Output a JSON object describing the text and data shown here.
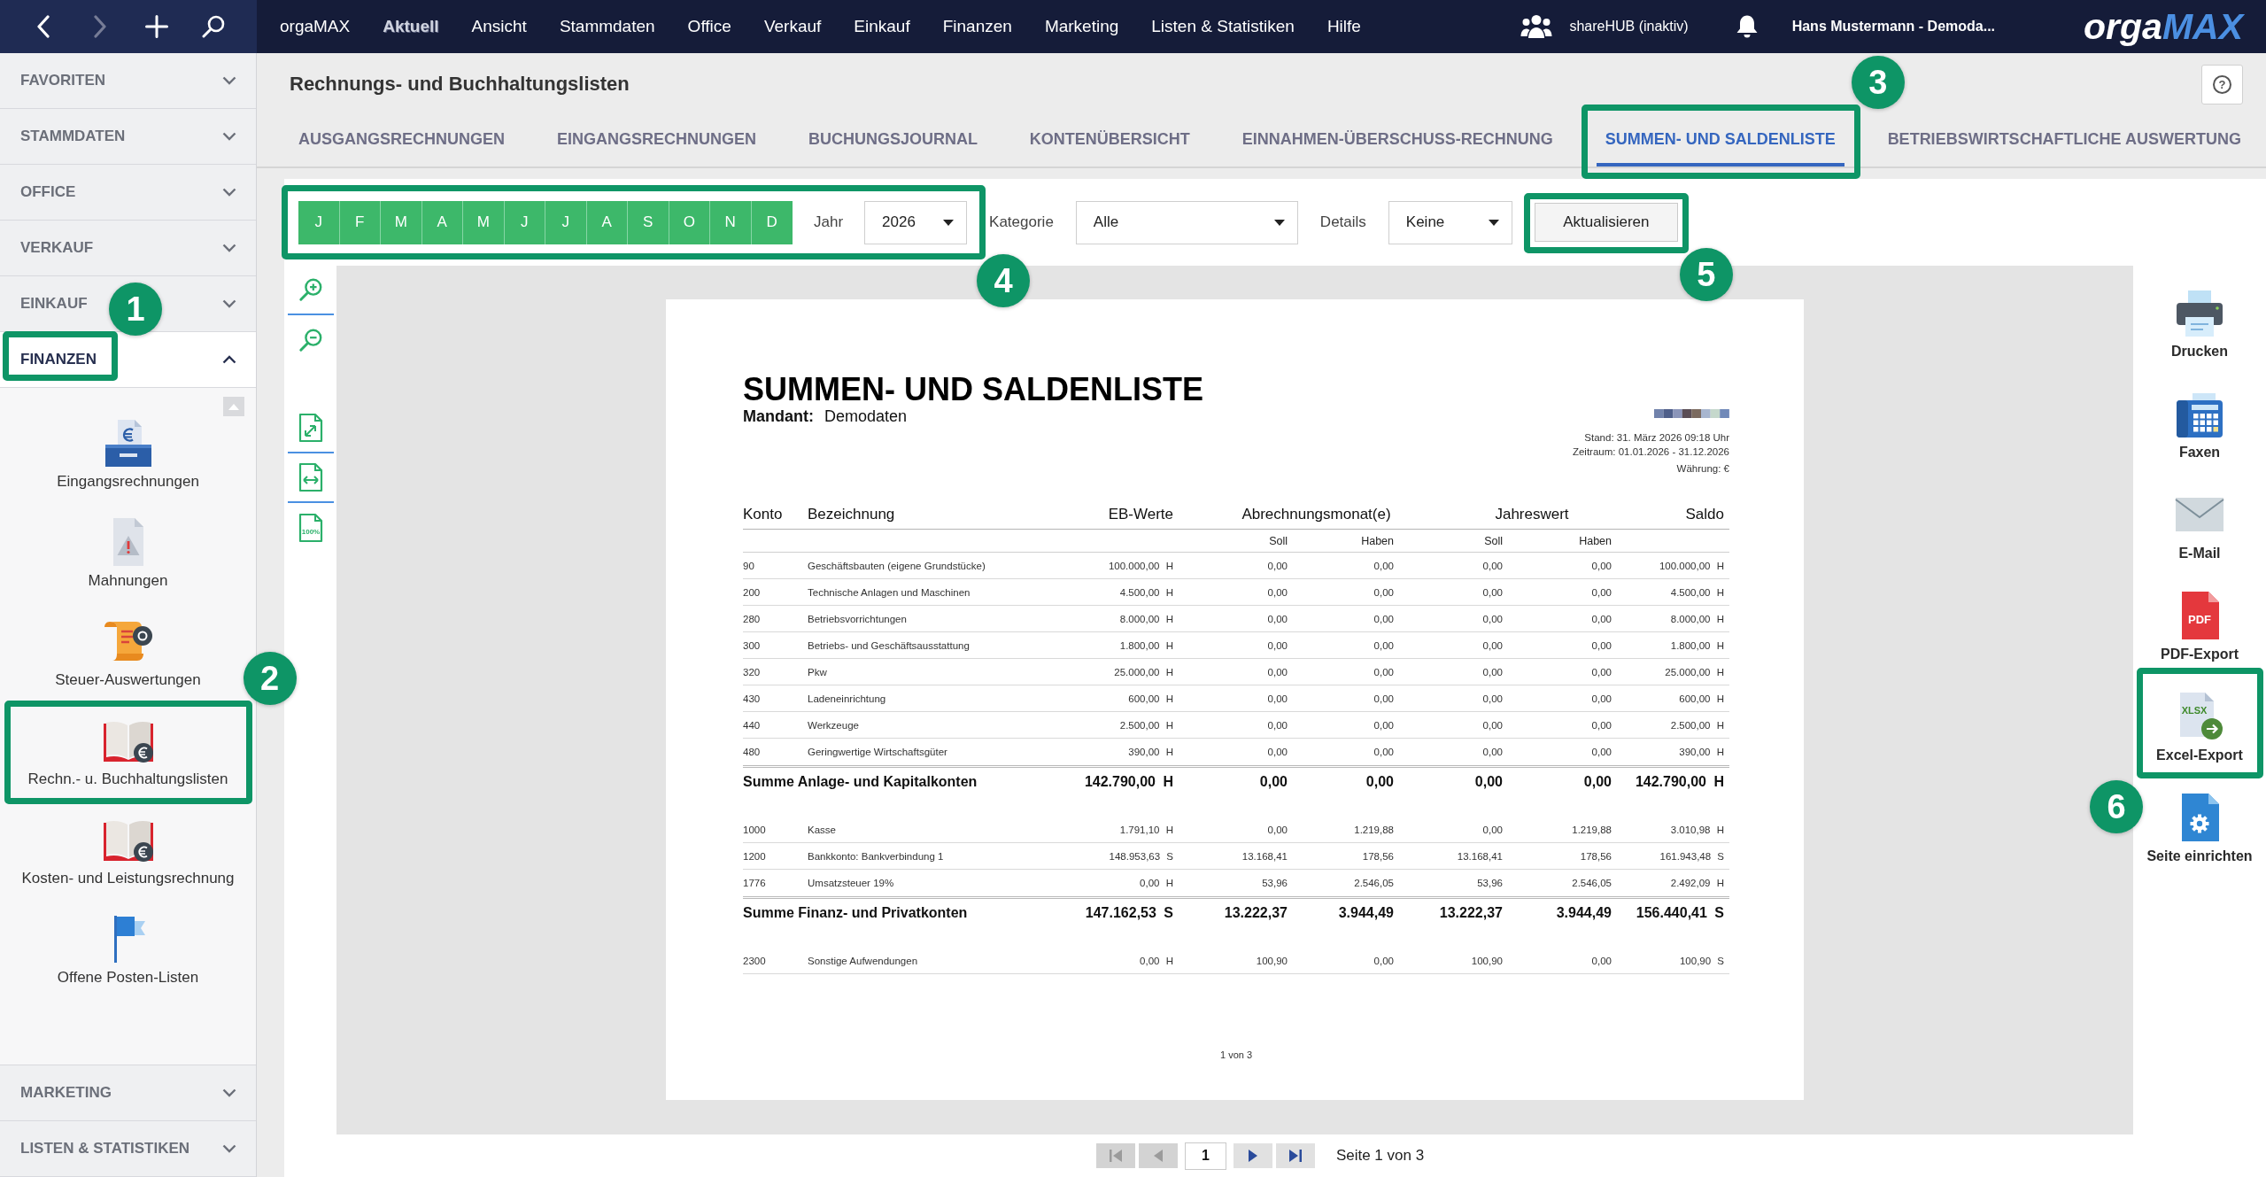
{
  "top_bar": {
    "nav": [
      {
        "kind": "back",
        "disabled": false
      },
      {
        "kind": "forward",
        "disabled": true
      },
      {
        "kind": "add",
        "disabled": false
      },
      {
        "kind": "search",
        "disabled": false
      }
    ],
    "menu": [
      {
        "label": "orgaMAX",
        "selected": false
      },
      {
        "label": "Aktuell",
        "selected": true
      },
      {
        "label": "Ansicht",
        "selected": false
      },
      {
        "label": "Stammdaten",
        "selected": false
      },
      {
        "label": "Office",
        "selected": false
      },
      {
        "label": "Verkauf",
        "selected": false
      },
      {
        "label": "Einkauf",
        "selected": false
      },
      {
        "label": "Finanzen",
        "selected": false
      },
      {
        "label": "Marketing",
        "selected": false
      },
      {
        "label": "Listen & Statistiken",
        "selected": false
      },
      {
        "label": "Hilfe",
        "selected": false
      }
    ],
    "sharehub": "shareHUB (inaktiv)",
    "user": "Hans Mustermann - Demoda...",
    "logo": {
      "first": "orga",
      "second": "MAX"
    }
  },
  "sidebar": {
    "sections": [
      {
        "label": "FAVORITEN",
        "expanded": false
      },
      {
        "label": "STAMMDATEN",
        "expanded": false
      },
      {
        "label": "OFFICE",
        "expanded": false
      },
      {
        "label": "VERKAUF",
        "expanded": false
      },
      {
        "label": "EINKAUF",
        "expanded": false
      },
      {
        "label": "FINANZEN",
        "expanded": true,
        "callout": {
          "number": "1"
        },
        "items": [
          {
            "label": "Eingangsrechnungen",
            "kind": "inbox"
          },
          {
            "label": "Mahnungen",
            "kind": "warning"
          },
          {
            "label": "Steuer-Auswertungen",
            "kind": "scroll"
          },
          {
            "label": "Rechn.- u. Buchhaltungslisten",
            "kind": "book",
            "callout": {
              "number": "2"
            }
          },
          {
            "label": "Kosten- und Leistungsrechnung",
            "kind": "book"
          },
          {
            "label": "Offene Posten-Listen",
            "kind": "flag"
          }
        ]
      },
      {
        "label": "MARKETING",
        "expanded": false
      },
      {
        "label": "LISTEN & STATISTIKEN",
        "expanded": false
      }
    ]
  },
  "view": {
    "title": "Rechnungs- und Buchhaltungslisten",
    "help_button": "?",
    "tabs": [
      {
        "label": "AUSGANGSRECHNUNGEN",
        "selected": false
      },
      {
        "label": "EINGANGSRECHNUNGEN",
        "selected": false
      },
      {
        "label": "BUCHUNGSJOURNAL",
        "selected": false
      },
      {
        "label": "KONTENÜBERSICHT",
        "selected": false
      },
      {
        "label": "EINNAHMEN-ÜBERSCHUSS-RECHNUNG",
        "selected": false
      },
      {
        "label": "SUMMEN- UND SALDENLISTE",
        "selected": true,
        "callout": {
          "number": "3"
        }
      },
      {
        "label": "BETRIEBSWIRTSCHAFTLICHE AUSWERTUNG",
        "selected": false
      }
    ]
  },
  "toolbar": {
    "months": [
      {
        "label": "J",
        "selected": true
      },
      {
        "label": "F",
        "selected": true
      },
      {
        "label": "M",
        "selected": true
      },
      {
        "label": "A",
        "selected": true
      },
      {
        "label": "M",
        "selected": true
      },
      {
        "label": "J",
        "selected": true
      },
      {
        "label": "J",
        "selected": true
      },
      {
        "label": "A",
        "selected": true
      },
      {
        "label": "S",
        "selected": true
      },
      {
        "label": "O",
        "selected": true
      },
      {
        "label": "N",
        "selected": true
      },
      {
        "label": "D",
        "selected": true
      }
    ],
    "year": {
      "label": "Jahr",
      "value": "2026"
    },
    "callout": {
      "number": "4"
    },
    "category": {
      "label": "Kategorie",
      "value": "Alle"
    },
    "details": {
      "label": "Details",
      "value": "Keine"
    },
    "refresh": {
      "label": "Aktualisieren",
      "callout": {
        "number": "5"
      }
    }
  },
  "view_tools": [
    {
      "kind": "zoom-in"
    },
    {
      "kind": "zoom-out"
    },
    {
      "kind": "fit-page"
    },
    {
      "kind": "fit-width"
    },
    {
      "kind": "actual-size",
      "label": "100%"
    }
  ],
  "report": {
    "title": "SUMMEN- UND SALDENLISTE",
    "client_label": "Mandant:",
    "client": "Demodaten",
    "meta": [
      "Stand: 31. März 2026 09:18 Uhr",
      "Zeitraum: 01.01.2026 - 31.12.2026",
      "Währung: €"
    ],
    "columns": [
      "Konto",
      "Bezeichnung",
      "EB-Werte",
      "Abrechnungsmonat(e)",
      "Jahreswert",
      "Saldo"
    ],
    "subcolumns": [
      "Soll",
      "Haben",
      "Soll",
      "Haben"
    ],
    "groups": [
      {
        "rows": [
          {
            "account": "90",
            "name": "Geschäftsbauten (eigene Grundstücke)",
            "opening": "100.000,00 H",
            "month_debit": "0,00",
            "month_credit": "0,00",
            "year_debit": "0,00",
            "year_credit": "0,00",
            "balance": "100.000,00 H"
          },
          {
            "account": "200",
            "name": "Technische Anlagen und Maschinen",
            "opening": "4.500,00 H",
            "month_debit": "0,00",
            "month_credit": "0,00",
            "year_debit": "0,00",
            "year_credit": "0,00",
            "balance": "4.500,00 H"
          },
          {
            "account": "280",
            "name": "Betriebsvorrichtungen",
            "opening": "8.000,00 H",
            "month_debit": "0,00",
            "month_credit": "0,00",
            "year_debit": "0,00",
            "year_credit": "0,00",
            "balance": "8.000,00 H"
          },
          {
            "account": "300",
            "name": "Betriebs- und Geschäftsausstattung",
            "opening": "1.800,00 H",
            "month_debit": "0,00",
            "month_credit": "0,00",
            "year_debit": "0,00",
            "year_credit": "0,00",
            "balance": "1.800,00 H"
          },
          {
            "account": "320",
            "name": "Pkw",
            "opening": "25.000,00 H",
            "month_debit": "0,00",
            "month_credit": "0,00",
            "year_debit": "0,00",
            "year_credit": "0,00",
            "balance": "25.000,00 H"
          },
          {
            "account": "430",
            "name": "Ladeneinrichtung",
            "opening": "600,00 H",
            "month_debit": "0,00",
            "month_credit": "0,00",
            "year_debit": "0,00",
            "year_credit": "0,00",
            "balance": "600,00 H"
          },
          {
            "account": "440",
            "name": "Werkzeuge",
            "opening": "2.500,00 H",
            "month_debit": "0,00",
            "month_credit": "0,00",
            "year_debit": "0,00",
            "year_credit": "0,00",
            "balance": "2.500,00 H"
          },
          {
            "account": "480",
            "name": "Geringwertige Wirtschaftsgüter",
            "opening": "390,00 H",
            "month_debit": "0,00",
            "month_credit": "0,00",
            "year_debit": "0,00",
            "year_credit": "0,00",
            "balance": "390,00 H"
          }
        ],
        "total": {
          "label": "Summe Anlage- und Kapitalkonten",
          "opening": "142.790,00 H",
          "month_debit": "0,00",
          "month_credit": "0,00",
          "year_debit": "0,00",
          "year_credit": "0,00",
          "balance": "142.790,00 H"
        }
      },
      {
        "rows": [
          {
            "account": "1000",
            "name": "Kasse",
            "opening": "1.791,10 H",
            "month_debit": "0,00",
            "month_credit": "1.219,88",
            "year_debit": "0,00",
            "year_credit": "1.219,88",
            "balance": "3.010,98 H"
          },
          {
            "account": "1200",
            "name": "Bankkonto: Bankverbindung 1",
            "opening": "148.953,63 S",
            "month_debit": "13.168,41",
            "month_credit": "178,56",
            "year_debit": "13.168,41",
            "year_credit": "178,56",
            "balance": "161.943,48 S"
          },
          {
            "account": "1776",
            "name": "Umsatzsteuer 19%",
            "opening": "0,00 H",
            "month_debit": "53,96",
            "month_credit": "2.546,05",
            "year_debit": "53,96",
            "year_credit": "2.546,05",
            "balance": "2.492,09 H"
          }
        ],
        "total": {
          "label": "Summe Finanz- und Privatkonten",
          "opening": "147.162,53 S",
          "month_debit": "13.222,37",
          "month_credit": "3.944,49",
          "year_debit": "13.222,37",
          "year_credit": "3.944,49",
          "balance": "156.440,41 S"
        }
      },
      {
        "rows": [
          {
            "account": "2300",
            "name": "Sonstige Aufwendungen",
            "opening": "0,00 H",
            "month_debit": "100,90",
            "month_credit": "0,00",
            "year_debit": "100,90",
            "year_credit": "0,00",
            "balance": "100,90 S"
          }
        ]
      }
    ],
    "page_number": "1 von 3"
  },
  "actions": [
    {
      "label": "Drucken",
      "kind": "print"
    },
    {
      "label": "Faxen",
      "kind": "fax"
    },
    {
      "label": "E-Mail",
      "kind": "mail"
    },
    {
      "label": "PDF-Export",
      "kind": "pdf",
      "icon_text": "PDF"
    },
    {
      "label": "Excel-Export",
      "kind": "xlsx",
      "icon_text": "XLSX",
      "callout": {
        "number": "6"
      }
    },
    {
      "label": "Seite einrichten",
      "kind": "page-setup"
    }
  ],
  "pager": {
    "items": [
      {
        "kind": "first",
        "disabled": true
      },
      {
        "kind": "previous",
        "disabled": true
      },
      {
        "kind": "page",
        "value": "1"
      },
      {
        "kind": "next",
        "disabled": false
      },
      {
        "kind": "last",
        "disabled": false
      }
    ],
    "status": "Seite 1 von 3"
  }
}
